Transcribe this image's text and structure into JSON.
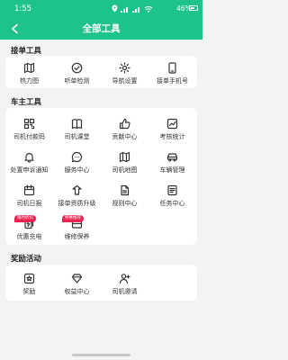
{
  "status_bar": {
    "time": "1:55",
    "battery_percent": "46%",
    "battery_level": 0.46,
    "icons": [
      "location-icon",
      "wifi-icon",
      "signal-icon",
      "signal-icon"
    ]
  },
  "header": {
    "title": "全部工具",
    "back_icon": "back-arrow-icon"
  },
  "sections": [
    {
      "id": "order-tools",
      "title": "接单工具",
      "items": [
        {
          "label": "热力图",
          "icon": "map-icon"
        },
        {
          "label": "听单检测",
          "icon": "check-circle-icon"
        },
        {
          "label": "导航设置",
          "icon": "gear-icon"
        },
        {
          "label": "接单手机号",
          "icon": "phone-icon"
        }
      ]
    },
    {
      "id": "driver-tools",
      "title": "车主工具",
      "items": [
        {
          "label": "司机付款码",
          "icon": "qr-code-icon"
        },
        {
          "label": "司机课堂",
          "icon": "book-icon"
        },
        {
          "label": "贡献中心",
          "icon": "thumbs-up-icon"
        },
        {
          "label": "考核统计",
          "icon": "trend-chart-icon"
        },
        {
          "label": "处置申诉通知",
          "icon": "notification-icon"
        },
        {
          "label": "服务中心",
          "icon": "chat-icon"
        },
        {
          "label": "司机地图",
          "icon": "map-icon"
        },
        {
          "label": "车辆管理",
          "icon": "car-icon"
        },
        {
          "label": "司机日报",
          "icon": "calendar-icon"
        },
        {
          "label": "接单资质升级",
          "icon": "upgrade-icon"
        },
        {
          "label": "规则中心",
          "icon": "document-icon"
        },
        {
          "label": "任务中心",
          "icon": "task-list-icon"
        },
        {
          "label": "优惠充电",
          "icon": "charging-icon",
          "badge": "限时折扣"
        },
        {
          "label": "维修保养",
          "icon": "wrench-icon",
          "badge": "特惠推荐"
        }
      ]
    },
    {
      "id": "reward-activities",
      "title": "奖励活动",
      "items": [
        {
          "label": "奖励",
          "icon": "reward-icon"
        },
        {
          "label": "权益中心",
          "icon": "diamond-icon"
        },
        {
          "label": "司机邀请",
          "icon": "invite-user-icon"
        }
      ]
    }
  ],
  "colors": {
    "header_bg": "#1ec28b",
    "page_bg": "#f2f3f5",
    "card_bg": "#ffffff",
    "badge_bg": "#ee2250",
    "icon": "#333333"
  }
}
